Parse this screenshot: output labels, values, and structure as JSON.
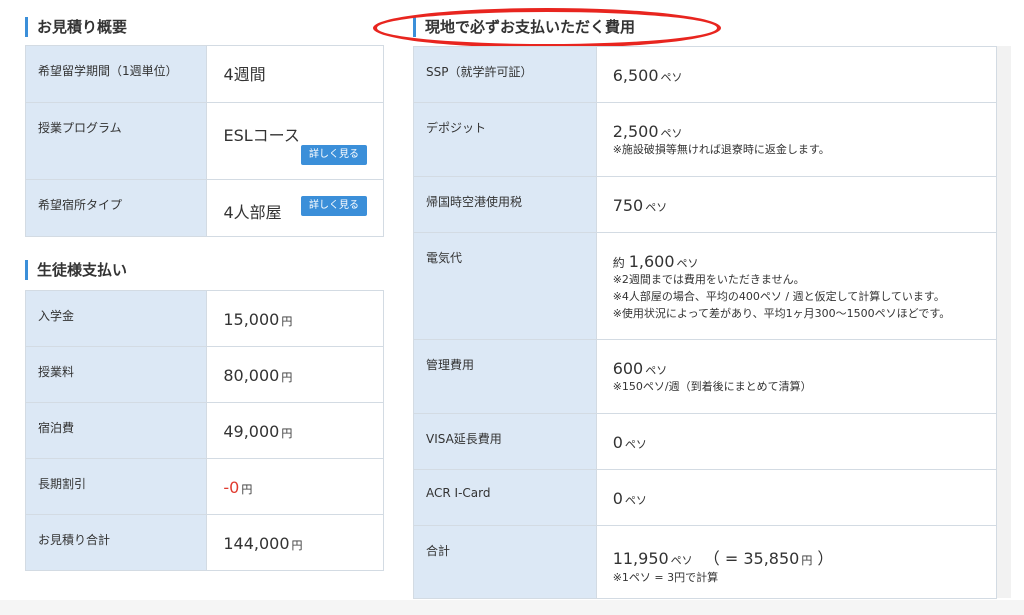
{
  "estimate": {
    "title": "お見積り概要",
    "rows": [
      {
        "label": "希望留学期間（1週単位）",
        "value": "4週間"
      },
      {
        "label": "授業プログラム",
        "value": "ESLコース",
        "button": "詳しく見る"
      },
      {
        "label": "希望宿所タイプ",
        "value": "4人部屋",
        "button": "詳しく見る"
      }
    ]
  },
  "payment": {
    "title": "生徒様支払い",
    "unit": "円",
    "rows": [
      {
        "label": "入学金",
        "value": "15,000"
      },
      {
        "label": "授業料",
        "value": "80,000"
      },
      {
        "label": "宿泊費",
        "value": "49,000"
      },
      {
        "label": "長期割引",
        "value": "-0"
      },
      {
        "label": "お見積り合計",
        "value": "144,000"
      }
    ]
  },
  "local_fees": {
    "title": "現地で必ずお支払いただく費用",
    "unit": "ペソ",
    "rows": [
      {
        "label": "SSP（就学許可証）",
        "value": "6,500"
      },
      {
        "label": "デポジット",
        "value": "2,500",
        "notes": [
          "※施設破損等無ければ退寮時に返金します。"
        ]
      },
      {
        "label": "帰国時空港使用税",
        "value": "750"
      },
      {
        "label": "電気代",
        "prefix": "約",
        "value": "1,600",
        "notes": [
          "※2週間までは費用をいただきません。",
          "※4人部屋の場合、平均の400ペソ / 週と仮定して計算しています。",
          "※使用状況によって差があり、平均1ヶ月300〜1500ペソほどです。"
        ]
      },
      {
        "label": "管理費用",
        "value": "600",
        "notes": [
          "※150ペソ/週（到着後にまとめて清算）"
        ]
      },
      {
        "label": "VISA延長費用",
        "value": "0"
      },
      {
        "label": "ACR I-Card",
        "value": "0"
      },
      {
        "label": "合計",
        "value": "11,950",
        "extra_open": "（ = ",
        "extra_value": "35,850",
        "extra_unit": "円",
        "extra_close": " ）",
        "notes": [
          "※1ペソ = 3円で計算"
        ]
      }
    ]
  },
  "colors": {
    "label_bg": "#dce8f5",
    "accent": "#3b8fd9",
    "highlight": "#e8251f",
    "negative": "#e03b2f"
  }
}
